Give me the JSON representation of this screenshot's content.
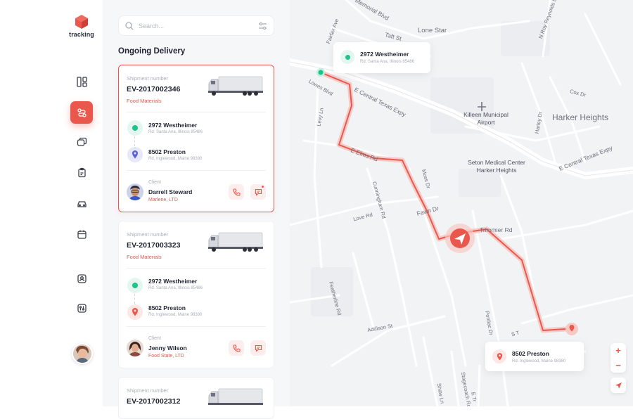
{
  "app": {
    "logo_text": "tracking",
    "accent": "#e9574d"
  },
  "sidebar": {
    "items": [
      {
        "name": "dashboard",
        "icon": "dashboard-icon",
        "active": false
      },
      {
        "name": "tracking",
        "icon": "route-icon",
        "active": true
      },
      {
        "name": "messages",
        "icon": "messages-icon",
        "active": false
      },
      {
        "name": "orders",
        "icon": "clipboard-icon",
        "active": false
      },
      {
        "name": "vehicles",
        "icon": "car-icon",
        "active": false
      },
      {
        "name": "calendar",
        "icon": "calendar-icon",
        "active": false
      },
      {
        "name": "contacts",
        "icon": "contact-icon",
        "active": false
      },
      {
        "name": "settings",
        "icon": "settings-icon",
        "active": false
      }
    ]
  },
  "search": {
    "placeholder": "Search..."
  },
  "panel": {
    "title": "Ongoing Delivery"
  },
  "shipments": [
    {
      "label": "Shipment number",
      "number": "EV-2017002346",
      "category": "Food Materials",
      "from": {
        "name": "2972 Westheimer",
        "address": "Rd. Santa Ana, Illinois 85486"
      },
      "to": {
        "name": "8502 Preston",
        "address": "Rd. Inglewood, Maine 98380"
      },
      "client_label": "Client",
      "client_name": "Darrell Steward",
      "client_company": "Marlene, LTD"
    },
    {
      "label": "Shipment number",
      "number": "EV-2017003323",
      "category": "Food Materials",
      "from": {
        "name": "2972 Westheimer",
        "address": "Rd. Santa Ana, Illinois 85486"
      },
      "to": {
        "name": "8502 Preston",
        "address": "Rd. Inglewood, Maine 98380"
      },
      "client_label": "Client",
      "client_name": "Jenny Wilson",
      "client_company": "Food State, LTD"
    },
    {
      "label": "Shipment number",
      "number": "EV-2017002312"
    }
  ],
  "map": {
    "origin": {
      "name": "2972 Westheimer",
      "address": "Rd. Santa Ana, Illinois 85486"
    },
    "destination": {
      "name": "8502 Preston",
      "address": "Rd. Inglewood, Maine 98380"
    },
    "labels": {
      "memorial": "Memorial Blvd",
      "lone_star": "Lone Star",
      "taft": "Taft St",
      "n_roy": "N Roy Reynolds Dr",
      "s_fairfax": "Fairfax Ave",
      "lowes": "Lowes Blvd",
      "e_central": "E Central Texas Expy",
      "e_central_2": "E Central Texas Expy",
      "cox": "Cox Dr",
      "airport": "Killeen Municipal Airport",
      "harker": "Harker Heights",
      "harley": "Harley Dr",
      "levy": "Levy Ln",
      "seton": "Seton Medical Center Harker Heights",
      "elms": "E Elms Rd",
      "cunningham": "Cunningham Rd",
      "moss": "Moss Dr",
      "fawn": "Fawn Dr",
      "love": "Love Rd",
      "trimmier": "Trimmier Rd",
      "feather": "Featherline Rd",
      "addison": "Addison St",
      "pontiac": "Pontiac Dr",
      "stagecoach": "Stagecoach Rd",
      "shaw": "Shaw Ln",
      "e_trim": "E Tr",
      "sta": "S T"
    },
    "zoom_in": "+",
    "zoom_out": "−"
  }
}
